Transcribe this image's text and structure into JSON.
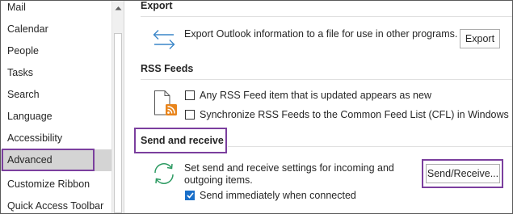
{
  "sidebar": {
    "items": [
      {
        "label": "Mail"
      },
      {
        "label": "Calendar"
      },
      {
        "label": "People"
      },
      {
        "label": "Tasks"
      },
      {
        "label": "Search"
      },
      {
        "label": "Language"
      },
      {
        "label": "Accessibility"
      },
      {
        "label": "Advanced",
        "selected": true
      },
      {
        "label": "Customize Ribbon"
      },
      {
        "label": "Quick Access Toolbar"
      }
    ]
  },
  "export": {
    "heading": "Export",
    "description": "Export Outlook information to a file for use in other programs.",
    "button_label": "Export",
    "icon": "export-arrows-icon"
  },
  "rss": {
    "heading": "RSS Feeds",
    "icon": "rss-document-icon",
    "option1": {
      "label": "Any RSS Feed item that is updated appears as new",
      "checked": false
    },
    "option2": {
      "label": "Synchronize RSS Feeds to the Common Feed List (CFL) in Windows",
      "checked": false
    }
  },
  "send_receive": {
    "heading": "Send and receive",
    "icon": "sync-arrows-icon",
    "description_line1": "Set send and receive settings for incoming and",
    "description_line2": "outgoing items.",
    "button_label": "Send/Receive...",
    "option": {
      "label": "Send immediately when connected",
      "checked": true
    }
  },
  "colors": {
    "highlight_outline": "#7b3f9e",
    "selected_bg": "#d4d4d4",
    "accent_blue": "#1a6fc9",
    "icon_green": "#2e9b63",
    "rss_orange": "#e8841b"
  }
}
